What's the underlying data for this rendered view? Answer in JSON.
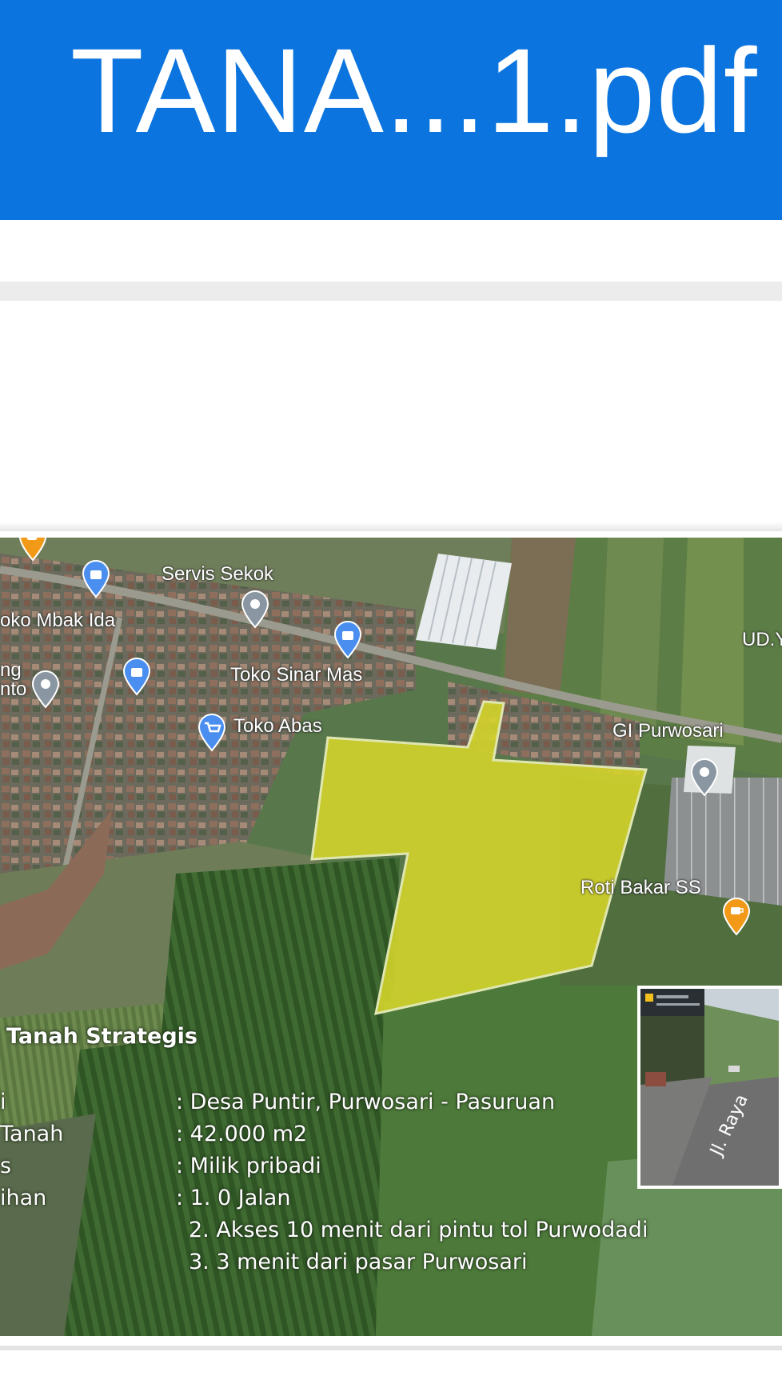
{
  "header": {
    "title": "TANA...1.pdf"
  },
  "map": {
    "places": [
      {
        "name": "Servis Sekok",
        "icon": "map-pin-icon"
      },
      {
        "name": "oko Mbak Ida",
        "icon": "shopping-bag-pin-icon"
      },
      {
        "name": "Toko Sinar Mas",
        "icon": "shopping-bag-pin-icon"
      },
      {
        "name": "ng",
        "icon": "map-pin-icon"
      },
      {
        "name": "nto",
        "icon": "map-pin-icon"
      },
      {
        "name": "Toko Abas",
        "icon": "shopping-cart-pin-icon"
      },
      {
        "name": "GI Purwosari",
        "icon": "map-pin-icon"
      },
      {
        "name": "UD.Y",
        "icon": "map-pin-icon"
      },
      {
        "name": "Roti Bakar SS",
        "icon": "coffee-pin-icon"
      }
    ],
    "pin_colors": {
      "blue": "#4a8ff0",
      "gray": "#8a97a3",
      "orange": "#f29a18"
    },
    "plot_color": "#d6d62a",
    "street_label": "Jl. Raya"
  },
  "info": {
    "title": "Tanah Strategis",
    "rows": [
      {
        "label": "i",
        "value": ": Desa Puntir, Purwosari - Pasuruan"
      },
      {
        "label": "Tanah",
        "value": ": 42.000 m2"
      },
      {
        "label": "s",
        "value": ": Milik pribadi"
      },
      {
        "label": "ihan",
        "value": ": 1. 0 Jalan"
      },
      {
        "label": "",
        "value": "2. Akses 10 menit dari pintu tol Purwodadi"
      },
      {
        "label": "",
        "value": "3. 3 menit dari pasar Purwosari"
      }
    ]
  }
}
